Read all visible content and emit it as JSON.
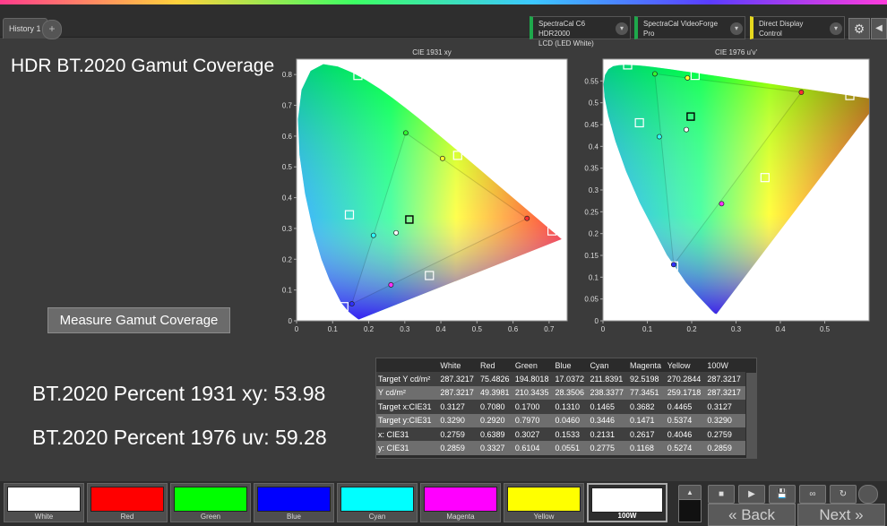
{
  "tabs": {
    "active": "History 1",
    "add": "+"
  },
  "dropdowns": [
    {
      "line1": "SpectraCal C6 HDR2000",
      "line2": "LCD (LED White)"
    },
    {
      "line1": "SpectraCal VideoForge Pro",
      "line2": ""
    },
    {
      "line1": "Direct Display Control",
      "line2": ""
    }
  ],
  "dropdown_arrow": "▾",
  "icons": {
    "gear": "⚙",
    "play_back": "◀",
    "stop": "■",
    "play": "▶",
    "save": "💾",
    "loop": "∞",
    "refresh": "↻",
    "up": "▲",
    "back_chevron": "«",
    "next_chevron": "»"
  },
  "page_title": "HDR BT.2020  Gamut Coverage",
  "measure_button": "Measure Gamut Coverage",
  "percent_1931": "BT.2020 Percent 1931 xy: 53.98",
  "percent_1976": "BT.2020 Percent 1976 uv: 59.28",
  "table": {
    "columns": [
      "",
      "White",
      "Red",
      "Green",
      "Blue",
      "Cyan",
      "Magenta",
      "Yellow",
      "100W"
    ],
    "rows": [
      [
        "Target Y cd/m²",
        "287.3217",
        "75.4826",
        "194.8018",
        "17.0372",
        "211.8391",
        "92.5198",
        "270.2844",
        "287.3217"
      ],
      [
        "Y cd/m²",
        "287.3217",
        "49.3981",
        "210.3435",
        "28.3506",
        "238.3377",
        "77.3451",
        "259.1718",
        "287.3217"
      ],
      [
        "Target x:CIE31",
        "0.3127",
        "0.7080",
        "0.1700",
        "0.1310",
        "0.1465",
        "0.3682",
        "0.4465",
        "0.3127"
      ],
      [
        "Target y:CIE31",
        "0.3290",
        "0.2920",
        "0.7970",
        "0.0460",
        "0.3446",
        "0.1471",
        "0.5374",
        "0.3290"
      ],
      [
        "x: CIE31",
        "0.2759",
        "0.6389",
        "0.3027",
        "0.1533",
        "0.2131",
        "0.2617",
        "0.4046",
        "0.2759"
      ],
      [
        "y: CIE31",
        "0.2859",
        "0.3327",
        "0.6104",
        "0.0551",
        "0.2775",
        "0.1168",
        "0.5274",
        "0.2859"
      ]
    ]
  },
  "swatches": [
    {
      "label": "White",
      "color": "#ffffff"
    },
    {
      "label": "Red",
      "color": "#ff0000"
    },
    {
      "label": "Green",
      "color": "#00ff00"
    },
    {
      "label": "Blue",
      "color": "#0000ff"
    },
    {
      "label": "Cyan",
      "color": "#00ffff"
    },
    {
      "label": "Magenta",
      "color": "#ff00ff"
    },
    {
      "label": "Yellow",
      "color": "#ffff00"
    },
    {
      "label": "100W",
      "color": "#ffffff"
    }
  ],
  "nav": {
    "back": "Back",
    "next": "Next"
  },
  "chart_data": [
    {
      "type": "scatter",
      "title": "CIE 1931 xy",
      "xlim": [
        0,
        0.75
      ],
      "ylim": [
        0,
        0.85
      ],
      "xticks": [
        "0",
        "0.1",
        "0.2",
        "0.3",
        "0.4",
        "0.5",
        "0.6",
        "0.7"
      ],
      "yticks": [
        "0",
        "0.1",
        "0.2",
        "0.3",
        "0.4",
        "0.5",
        "0.6",
        "0.7",
        "0.8"
      ],
      "targets": [
        {
          "name": "White",
          "x": 0.3127,
          "y": 0.329
        },
        {
          "name": "Red",
          "x": 0.708,
          "y": 0.292
        },
        {
          "name": "Green",
          "x": 0.17,
          "y": 0.797
        },
        {
          "name": "Blue",
          "x": 0.131,
          "y": 0.046
        },
        {
          "name": "Cyan",
          "x": 0.1465,
          "y": 0.3446
        },
        {
          "name": "Magenta",
          "x": 0.3682,
          "y": 0.1471
        },
        {
          "name": "Yellow",
          "x": 0.4465,
          "y": 0.5374
        }
      ],
      "measured": [
        {
          "name": "White",
          "x": 0.2759,
          "y": 0.2859,
          "color": "#ffffff"
        },
        {
          "name": "Red",
          "x": 0.6389,
          "y": 0.3327,
          "color": "#ff3030"
        },
        {
          "name": "Green",
          "x": 0.3027,
          "y": 0.6104,
          "color": "#30ff30"
        },
        {
          "name": "Blue",
          "x": 0.1533,
          "y": 0.0551,
          "color": "#3030ff"
        },
        {
          "name": "Cyan",
          "x": 0.2131,
          "y": 0.2775,
          "color": "#30ffff"
        },
        {
          "name": "Magenta",
          "x": 0.2617,
          "y": 0.1168,
          "color": "#ff30ff"
        },
        {
          "name": "Yellow",
          "x": 0.4046,
          "y": 0.5274,
          "color": "#ffff30"
        }
      ]
    },
    {
      "type": "scatter",
      "title": "CIE 1976 u'v'",
      "xlim": [
        0,
        0.6
      ],
      "ylim": [
        0,
        0.6
      ],
      "xticks": [
        "0",
        "0.1",
        "0.2",
        "0.3",
        "0.4",
        "0.5"
      ],
      "yticks": [
        "0",
        "0.05",
        "0.1",
        "0.15",
        "0.2",
        "0.25",
        "0.3",
        "0.35",
        "0.4",
        "0.45",
        "0.5",
        "0.55"
      ],
      "targets": [
        {
          "name": "White",
          "x": 0.1978,
          "y": 0.4683
        },
        {
          "name": "Red",
          "x": 0.5566,
          "y": 0.5165
        },
        {
          "name": "Green",
          "x": 0.0556,
          "y": 0.5868
        },
        {
          "name": "Blue",
          "x": 0.1593,
          "y": 0.1258
        },
        {
          "name": "Cyan",
          "x": 0.0821,
          "y": 0.4541
        },
        {
          "name": "Magenta",
          "x": 0.3653,
          "y": 0.3284
        },
        {
          "name": "Yellow",
          "x": 0.2078,
          "y": 0.5628
        }
      ],
      "measured": [
        {
          "name": "White",
          "x": 0.188,
          "y": 0.4384,
          "color": "#ffffff"
        },
        {
          "name": "Red",
          "x": 0.4472,
          "y": 0.524,
          "color": "#ff3030"
        },
        {
          "name": "Green",
          "x": 0.117,
          "y": 0.5663,
          "color": "#30ff30"
        },
        {
          "name": "Blue",
          "x": 0.1594,
          "y": 0.1289,
          "color": "#3030ff"
        },
        {
          "name": "Cyan",
          "x": 0.127,
          "y": 0.4222,
          "color": "#30ffff"
        },
        {
          "name": "Magenta",
          "x": 0.2675,
          "y": 0.2685,
          "color": "#ff30ff"
        },
        {
          "name": "Yellow",
          "x": 0.1905,
          "y": 0.557,
          "color": "#ffff30"
        }
      ]
    }
  ]
}
